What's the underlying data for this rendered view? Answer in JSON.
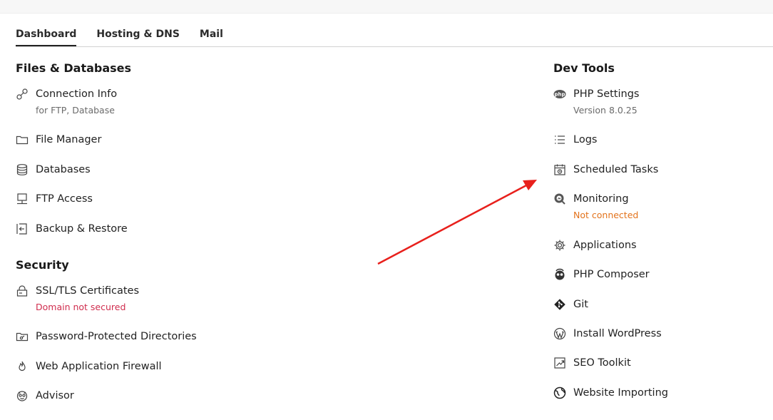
{
  "tabs": [
    {
      "label": "Dashboard",
      "active": true
    },
    {
      "label": "Hosting & DNS",
      "active": false
    },
    {
      "label": "Mail",
      "active": false
    }
  ],
  "files_section": {
    "title": "Files & Databases",
    "items": [
      {
        "label": "Connection Info",
        "sub": "for FTP, Database",
        "icon": "link-icon"
      },
      {
        "label": "File Manager",
        "icon": "folder-icon"
      },
      {
        "label": "Databases",
        "icon": "database-icon"
      },
      {
        "label": "FTP Access",
        "icon": "ftp-icon"
      },
      {
        "label": "Backup & Restore",
        "icon": "backup-icon"
      }
    ]
  },
  "security_section": {
    "title": "Security",
    "items": [
      {
        "label": "SSL/TLS Certificates",
        "sub": "Domain not secured",
        "icon": "certificate-lock-icon"
      },
      {
        "label": "Password-Protected Directories",
        "icon": "key-folder-icon"
      },
      {
        "label": "Web Application Firewall",
        "icon": "flame-icon"
      },
      {
        "label": "Advisor",
        "icon": "advisor-icon"
      }
    ]
  },
  "devtools_section": {
    "title": "Dev Tools",
    "items": [
      {
        "label": "PHP Settings",
        "sub": "Version 8.0.25",
        "icon": "php-icon"
      },
      {
        "label": "Logs",
        "icon": "list-icon"
      },
      {
        "label": "Scheduled Tasks",
        "icon": "calendar-clock-icon"
      },
      {
        "label": "Monitoring",
        "sub": "Not connected",
        "icon": "monitoring-icon"
      },
      {
        "label": "Applications",
        "icon": "gear-icon"
      },
      {
        "label": "PHP Composer",
        "icon": "composer-icon"
      },
      {
        "label": "Git",
        "icon": "git-icon"
      },
      {
        "label": "Install WordPress",
        "icon": "wordpress-icon"
      },
      {
        "label": "SEO Toolkit",
        "icon": "seo-chart-icon"
      },
      {
        "label": "Website Importing",
        "icon": "globe-import-icon"
      }
    ]
  },
  "colors": {
    "warning": "#e3731c",
    "error": "#d02d4e",
    "annotation_arrow": "#e8201c"
  }
}
